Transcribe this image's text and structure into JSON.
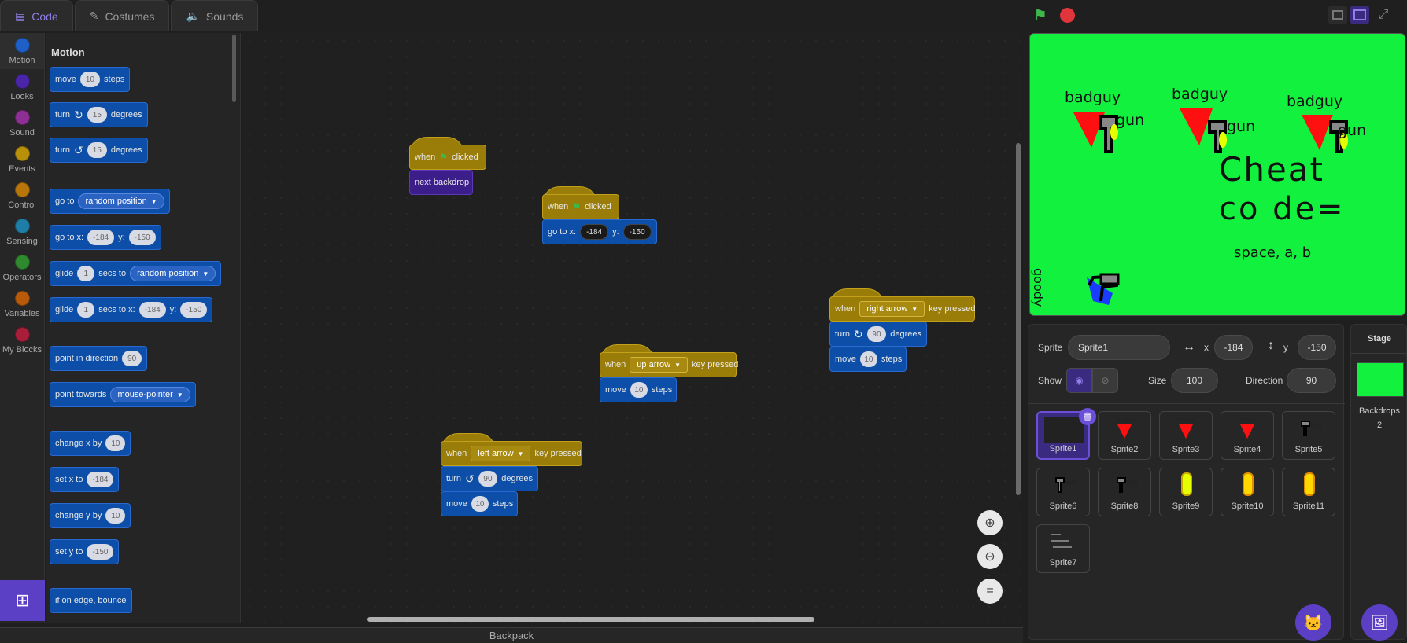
{
  "tabs": [
    {
      "label": "Code",
      "icon": "code-icon"
    },
    {
      "label": "Costumes",
      "icon": "brush-icon"
    },
    {
      "label": "Sounds",
      "icon": "speaker-icon"
    }
  ],
  "categories": [
    {
      "label": "Motion",
      "color": "#1f5fc8"
    },
    {
      "label": "Looks",
      "color": "#4a25a8"
    },
    {
      "label": "Sound",
      "color": "#8e2f95"
    },
    {
      "label": "Events",
      "color": "#b8900a"
    },
    {
      "label": "Control",
      "color": "#b8760a"
    },
    {
      "label": "Sensing",
      "color": "#1e7ea8"
    },
    {
      "label": "Operators",
      "color": "#2f8a2f"
    },
    {
      "label": "Variables",
      "color": "#b85a0a"
    },
    {
      "label": "My Blocks",
      "color": "#a81e3a"
    }
  ],
  "palette": {
    "heading": "Motion",
    "move": {
      "a": "move",
      "v": "10",
      "b": "steps"
    },
    "turn_right": {
      "a": "turn",
      "v": "15",
      "b": "degrees"
    },
    "turn_left": {
      "a": "turn",
      "v": "15",
      "b": "degrees"
    },
    "goto": {
      "a": "go to",
      "v": "random position"
    },
    "gotoxy": {
      "a": "go to x:",
      "x": "-184",
      "ylab": "y:",
      "y": "-150"
    },
    "glide": {
      "a": "glide",
      "v": "1",
      "b": "secs to",
      "c": "random position"
    },
    "glidexy": {
      "a": "glide",
      "v": "1",
      "b": "secs to x:",
      "x": "-184",
      "ylab": "y:",
      "y": "-150"
    },
    "point_dir": {
      "a": "point in direction",
      "v": "90"
    },
    "point_to": {
      "a": "point towards",
      "v": "mouse-pointer"
    },
    "change_x": {
      "a": "change x by",
      "v": "10"
    },
    "set_x": {
      "a": "set x to",
      "v": "-184"
    },
    "change_y": {
      "a": "change y by",
      "v": "10"
    },
    "set_y": {
      "a": "set y to",
      "v": "-150"
    },
    "bounce": {
      "a": "if on edge, bounce"
    }
  },
  "scripts": {
    "s1": {
      "when": "when",
      "clicked": "clicked",
      "next": "next backdrop"
    },
    "s2": {
      "when": "when",
      "clicked": "clicked",
      "goto": "go to x:",
      "x": "-184",
      "ylab": "y:",
      "y": "-150"
    },
    "s3": {
      "when": "when",
      "key": "right arrow",
      "pressed": "key pressed",
      "turn": "turn",
      "deg": "90",
      "degrees": "degrees",
      "move": "move",
      "steps_v": "10",
      "steps": "steps"
    },
    "s4": {
      "when": "when",
      "key": "up arrow",
      "pressed": "key pressed",
      "move": "move",
      "steps_v": "10",
      "steps": "steps"
    },
    "s5": {
      "when": "when",
      "key": "left arrow",
      "pressed": "key pressed",
      "turn": "turn",
      "deg": "90",
      "degrees": "degrees",
      "move": "move",
      "steps_v": "10",
      "steps": "steps"
    }
  },
  "backpack": "Backpack",
  "stage": {
    "texts": [
      "badguy",
      "gun",
      "badguy",
      "gun",
      "badguy",
      "gun",
      "Cheat",
      "co de=",
      "space, a, b",
      "goody"
    ]
  },
  "sprite_info": {
    "sprite_label": "Sprite",
    "sprite_name": "Sprite1",
    "x_label": "x",
    "x": "-184",
    "y_label": "y",
    "y": "-150",
    "show_label": "Show",
    "size_label": "Size",
    "size": "100",
    "direction_label": "Direction",
    "direction": "90"
  },
  "sprites": [
    "Sprite1",
    "Sprite2",
    "Sprite3",
    "Sprite4",
    "Sprite5",
    "Sprite6",
    "Sprite8",
    "Sprite9",
    "Sprite10",
    "Sprite11",
    "Sprite7"
  ],
  "stage_panel": {
    "title": "Stage",
    "backdrops_label": "Backdrops",
    "backdrops_count": "2"
  }
}
